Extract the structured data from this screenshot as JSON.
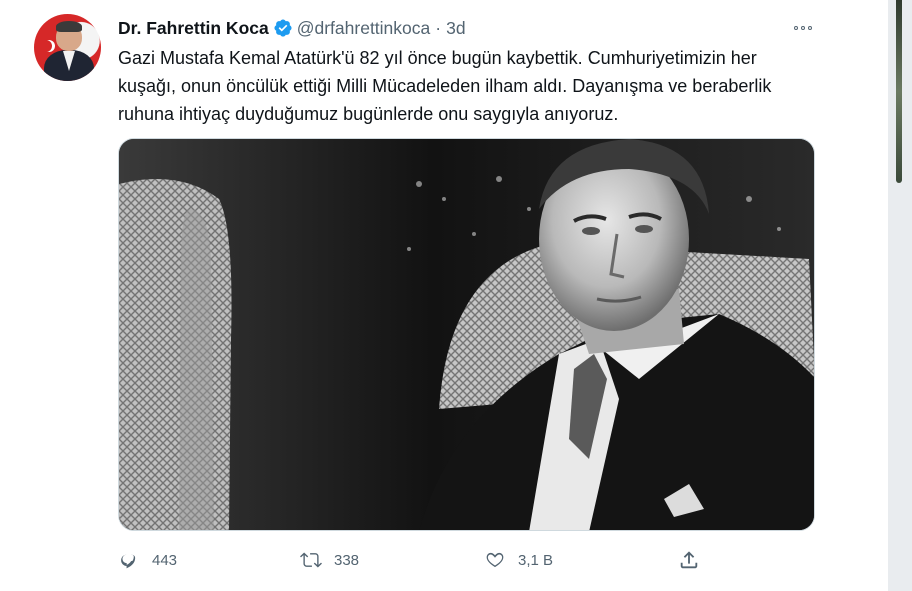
{
  "tweet": {
    "author": {
      "name": "Dr. Fahrettin Koca",
      "handle": "@drfahrettinkoca",
      "verified": true,
      "avatar_icon": "avatar-photo"
    },
    "separator": "·",
    "time": "3d",
    "text": "Gazi Mustafa Kemal Atatürk'ü 82 yıl önce bugün kaybettik. Cumhuriyetimizin her kuşağı, onun öncülük ettiği Milli Mücadeleden ilham aldı. Dayanışma ve beraberlik ruhuna ihtiyaç duyduğumuz bugünlerde onu saygıyla anıyoruz.",
    "media": {
      "type": "photo",
      "style": "black-and-white portrait"
    },
    "actions": {
      "reply": {
        "icon": "reply-icon",
        "count": "443"
      },
      "retweet": {
        "icon": "retweet-icon",
        "count": "338"
      },
      "like": {
        "icon": "heart-icon",
        "count": "3,1 B"
      },
      "share": {
        "icon": "share-icon"
      }
    },
    "more_icon": "more-options-icon"
  },
  "colors": {
    "text_primary": "#0f1419",
    "text_secondary": "#536471",
    "verified_blue": "#1d9bf0",
    "border": "#cfd9de"
  }
}
